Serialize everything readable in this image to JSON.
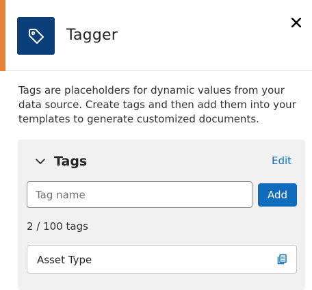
{
  "header": {
    "title": "Tagger",
    "logo_icon": "tag-icon",
    "close_icon": "close-icon",
    "accent_color": "#e8833a",
    "logo_bg": "#0b3f7a"
  },
  "description": "Tags are placeholders for dynamic values from your data source. Create tags and then add them into your templates to generate customized documents.",
  "tags_section": {
    "title": "Tags",
    "expand_icon": "chevron-down-icon",
    "edit_label": "Edit",
    "input_placeholder": "Tag name",
    "add_label": "Add",
    "count_text": "2 / 100 tags",
    "items": [
      {
        "name": "Asset Type",
        "icon": "copy-icon"
      }
    ]
  },
  "colors": {
    "primary": "#0f6cbd",
    "panel_bg": "#f1f1f1"
  }
}
